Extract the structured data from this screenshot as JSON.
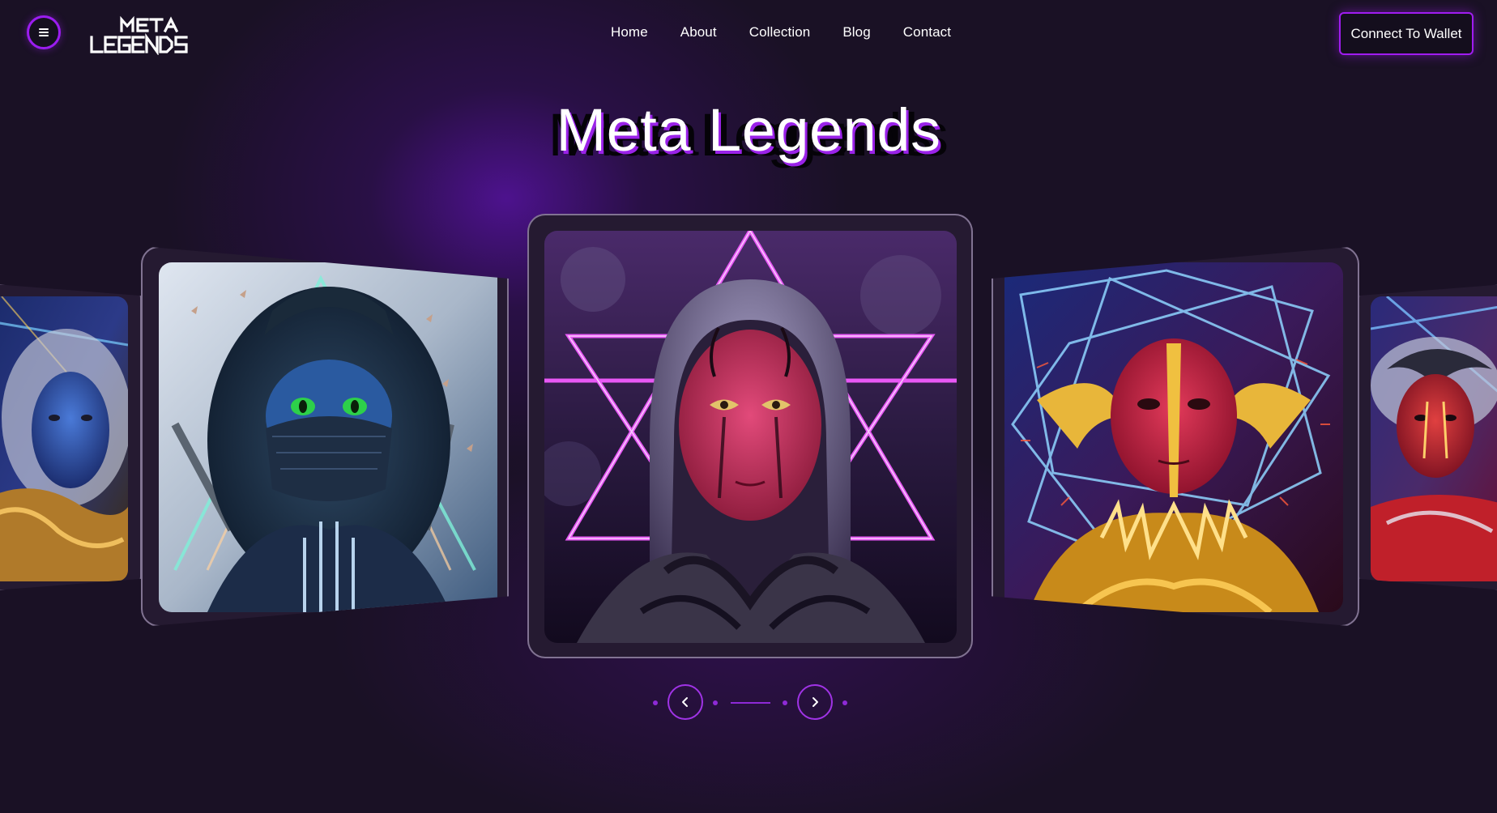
{
  "header": {
    "menu_icon": "hamburger-menu-icon",
    "logo_text": "META LEGENDS",
    "nav": [
      {
        "label": "Home"
      },
      {
        "label": "About"
      },
      {
        "label": "Collection"
      },
      {
        "label": "Blog"
      },
      {
        "label": "Contact"
      }
    ],
    "wallet_button": "Connect To Wallet"
  },
  "hero": {
    "title": "Meta Legends"
  },
  "carousel": {
    "cards": [
      {
        "name": "blue-hooded-legend",
        "position": "far-left"
      },
      {
        "name": "masked-ninja-legend",
        "position": "left"
      },
      {
        "name": "hooded-neon-triangle-legend",
        "position": "center"
      },
      {
        "name": "golden-horned-legend",
        "position": "right"
      },
      {
        "name": "red-armored-legend",
        "position": "far-right"
      }
    ],
    "controls": {
      "prev_icon": "chevron-left-icon",
      "next_icon": "chevron-right-icon"
    }
  },
  "colors": {
    "background": "#1a1125",
    "accent": "#9b1df0",
    "card_border": "#cdbee1"
  }
}
